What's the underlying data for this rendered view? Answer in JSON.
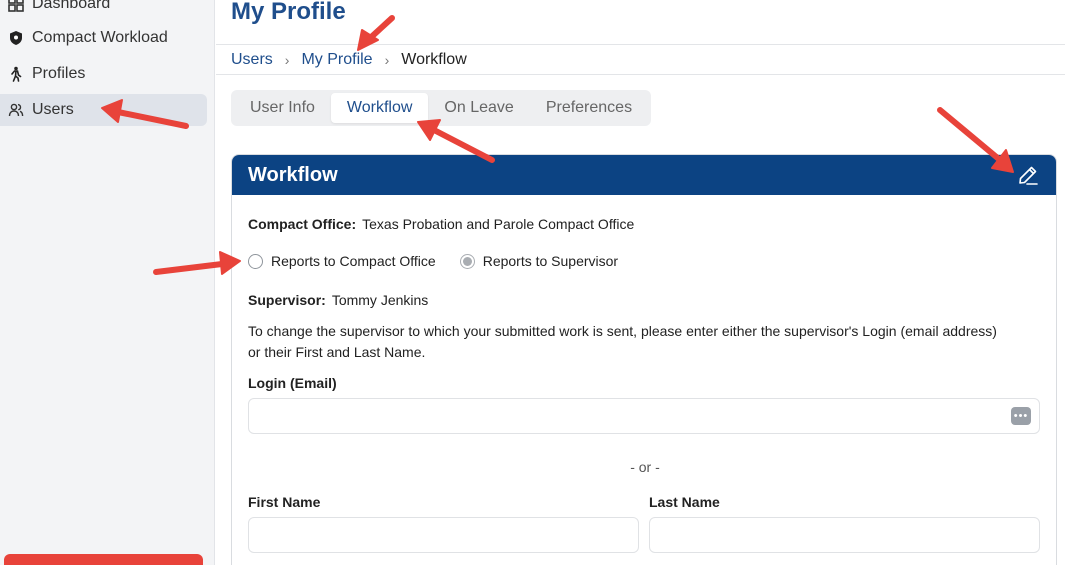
{
  "sidebar": {
    "items": [
      {
        "label": "Dashboard",
        "icon": "dashboard-icon"
      },
      {
        "label": "Compact Workload",
        "icon": "shield-icon"
      },
      {
        "label": "Profiles",
        "icon": "person-walking-icon"
      },
      {
        "label": "Users",
        "icon": "users-icon",
        "active": true
      }
    ]
  },
  "header": {
    "title": "My Profile"
  },
  "breadcrumb": {
    "items": [
      "Users",
      "My Profile",
      "Workflow"
    ],
    "separator": "›"
  },
  "tabs": [
    {
      "label": "User Info"
    },
    {
      "label": "Workflow",
      "active": true
    },
    {
      "label": "On Leave"
    },
    {
      "label": "Preferences"
    }
  ],
  "card": {
    "title": "Workflow",
    "compact_office_label": "Compact Office:",
    "compact_office_value": "Texas Probation and Parole Compact Office",
    "radio_options": [
      {
        "label": "Reports to Compact Office",
        "checked": false
      },
      {
        "label": "Reports to Supervisor",
        "checked": true
      }
    ],
    "supervisor_label": "Supervisor:",
    "supervisor_value": "Tommy Jenkins",
    "help_text": "To change the supervisor to which your submitted work is sent, please enter either the supervisor's Login (email address) or their First and Last Name.",
    "login_label": "Login (Email)",
    "login_value": "",
    "or_text": "- or -",
    "first_name_label": "First Name",
    "first_name_value": "",
    "last_name_label": "Last Name",
    "last_name_value": ""
  },
  "colors": {
    "primary": "#1f4e8c",
    "header_bg": "#0c4383",
    "annotation_arrow": "#e8433a"
  }
}
